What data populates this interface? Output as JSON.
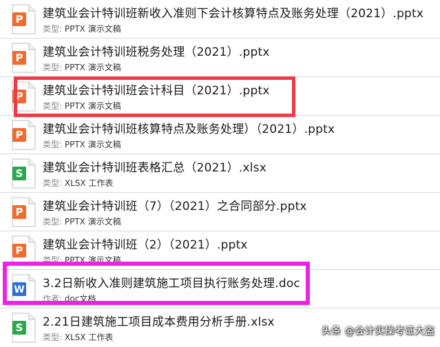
{
  "colors": {
    "ppt": "#f26b2e",
    "xls": "#2aa84a",
    "doc": "#2c6fd6"
  },
  "files": [
    {
      "name": "建筑业会计特训班新收入准则下会计核算特点及账务处理（2021）.pptx",
      "meta_key": "类型:",
      "meta_value": "PPTX 演示文稿",
      "icon": "ppt-file-icon",
      "letter": "P"
    },
    {
      "name": "建筑业会计特训班税务处理（2021）.pptx",
      "meta_key": "类型:",
      "meta_value": "PPTX 演示文稿",
      "icon": "ppt-file-icon",
      "letter": "P"
    },
    {
      "name": "建筑业会计特训班会计科目（2021）.pptx",
      "meta_key": "类型:",
      "meta_value": "PPTX 演示文稿",
      "icon": "ppt-file-icon",
      "letter": "P"
    },
    {
      "name": "建筑业会计特训班核算特点及账务处理）（2021）.pptx",
      "meta_key": "类型:",
      "meta_value": "PPTX 演示文稿",
      "icon": "ppt-file-icon",
      "letter": "P"
    },
    {
      "name": "建筑业会计特训班表格汇总（2021）.xlsx",
      "meta_key": "类型:",
      "meta_value": "XLSX 工作表",
      "icon": "xlsx-file-icon",
      "letter": "S"
    },
    {
      "name": "建筑业会计特训班（7）（2021）之合同部分.pptx",
      "meta_key": "类型:",
      "meta_value": "PPTX 演示文稿",
      "icon": "ppt-file-icon",
      "letter": "P"
    },
    {
      "name": "建筑业会计特训班（2）（2021）.pptx",
      "meta_key": "类型:",
      "meta_value": "PPTX 演示文稿",
      "icon": "ppt-file-icon",
      "letter": "P"
    },
    {
      "name": "3.2日新收入准则建筑施工项目执行账务处理.doc",
      "meta_key": "作者:",
      "meta_value": "doc文档",
      "icon": "doc-file-icon",
      "letter": "W"
    },
    {
      "name": "2.21日建筑施工项目成本费用分析手册.xlsx",
      "meta_key": "类型:",
      "meta_value": "XLSX 工作表",
      "icon": "xlsx-file-icon",
      "letter": "S"
    }
  ],
  "watermark": "头条 @会计实操考证大盗"
}
